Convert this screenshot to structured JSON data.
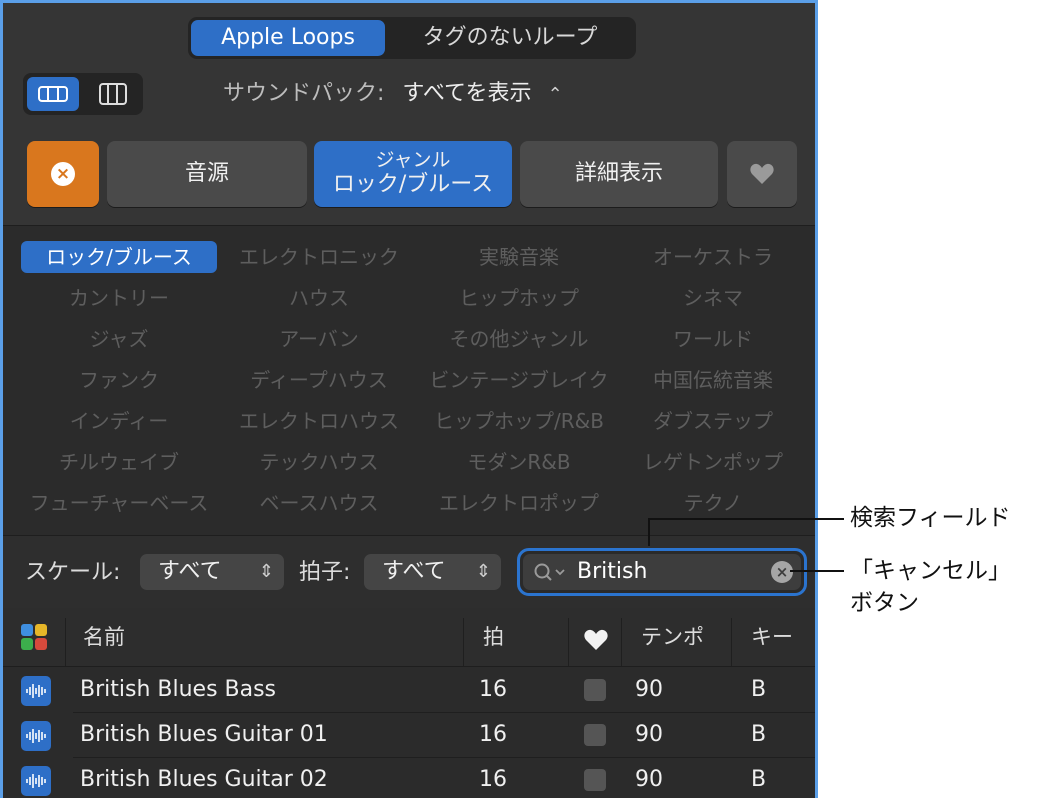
{
  "segmented": {
    "apple_loops": "Apple Loops",
    "untagged": "タグのないループ"
  },
  "soundpack": {
    "label": "サウンドパック:",
    "value": "すべてを表示"
  },
  "buttons": {
    "instrument": "音源",
    "genre_title": "ジャンル",
    "genre_value": "ロック/ブルース",
    "details": "詳細表示"
  },
  "genres": [
    "ロック/ブルース",
    "エレクトロニック",
    "実験音楽",
    "オーケストラ",
    "カントリー",
    "ハウス",
    "ヒップホップ",
    "シネマ",
    "ジャズ",
    "アーバン",
    "その他ジャンル",
    "ワールド",
    "ファンク",
    "ディープハウス",
    "ビンテージブレイク",
    "中国伝統音楽",
    "インディー",
    "エレクトロハウス",
    "ヒップホップ/R&B",
    "ダブステップ",
    "チルウェイブ",
    "テックハウス",
    "モダンR&B",
    "レゲトンポップ",
    "フューチャーベース",
    "ベースハウス",
    "エレクトロポップ",
    "テクノ"
  ],
  "filters": {
    "scale_label": "スケール:",
    "scale_value": "すべて",
    "time_label": "拍子:",
    "time_value": "すべて"
  },
  "search": {
    "value": "British"
  },
  "columns": {
    "name": "名前",
    "beats": "拍",
    "tempo": "テンポ",
    "key": "キー"
  },
  "rows": [
    {
      "name": "British Blues Bass",
      "beats": "16",
      "tempo": "90",
      "key": "B"
    },
    {
      "name": "British Blues Guitar 01",
      "beats": "16",
      "tempo": "90",
      "key": "B"
    },
    {
      "name": "British Blues Guitar 02",
      "beats": "16",
      "tempo": "90",
      "key": "B"
    }
  ],
  "callouts": {
    "search_field": "検索フィールド",
    "cancel_line1": "「キャンセル」",
    "cancel_line2": "ボタン"
  },
  "colors": {
    "accent": "#2e6fc7",
    "reset": "#d9771e",
    "panel": "#2b2b2b"
  }
}
